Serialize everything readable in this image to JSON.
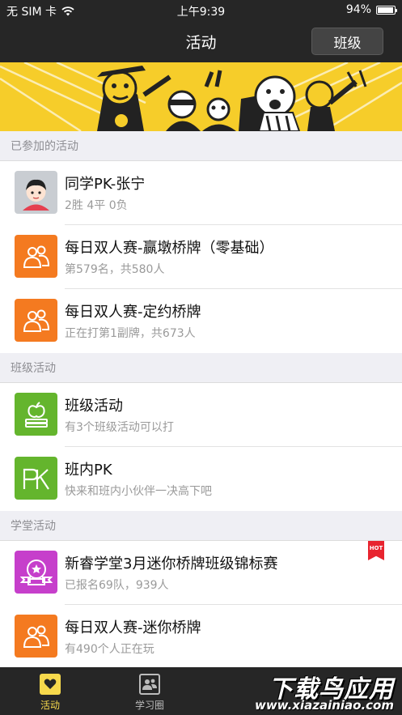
{
  "status_bar": {
    "carrier": "无 SIM 卡",
    "time": "上午9:39",
    "battery": "94%",
    "battery_level": 0.94
  },
  "nav": {
    "title": "活动",
    "class_button": "班级"
  },
  "sections": [
    {
      "header": "已参加的活动",
      "items": [
        {
          "title": "同学PK-张宁",
          "subtitle": "2胜 4平 0负",
          "icon": "avatar-icon"
        },
        {
          "title": "每日双人赛-赢墩桥牌（零基础）",
          "subtitle": "第579名，共580人",
          "icon": "pair-users-icon"
        },
        {
          "title": "每日双人赛-定约桥牌",
          "subtitle": "正在打第1副牌，共673人",
          "icon": "pair-users-icon"
        }
      ]
    },
    {
      "header": "班级活动",
      "items": [
        {
          "title": "班级活动",
          "subtitle": "有3个班级活动可以打",
          "icon": "apple-books-icon"
        },
        {
          "title": "班内PK",
          "subtitle": "快来和班内小伙伴一决高下吧",
          "icon": "pk-icon"
        }
      ]
    },
    {
      "header": "学堂活动",
      "items": [
        {
          "title": "新睿学堂3月迷你桥牌班级锦标赛",
          "subtitle": "已报名69队，939人",
          "icon": "trophy-badge-icon",
          "badge": "HOT"
        },
        {
          "title": "每日双人赛-迷你桥牌",
          "subtitle": "有490个人正在玩",
          "icon": "pair-users-icon"
        }
      ]
    }
  ],
  "tabs": [
    {
      "label": "活动",
      "icon": "heart-icon",
      "active": true
    },
    {
      "label": "学习圈",
      "icon": "contacts-icon",
      "active": false
    }
  ],
  "watermark": {
    "title": "下载鸟应用",
    "url": "www.xiazainiao.com"
  },
  "colors": {
    "bar": "#262626",
    "accent": "#f7d94c",
    "orange": "#f47a20",
    "green": "#64b52d",
    "purple": "#c63fcb",
    "hot": "#e8242f"
  }
}
